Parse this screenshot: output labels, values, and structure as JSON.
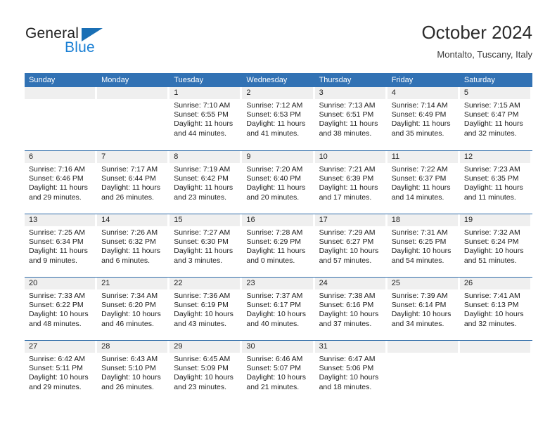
{
  "brand": {
    "name_part1": "General",
    "name_part2": "Blue",
    "triangle_color": "#1a6fb5",
    "blue_color": "#1a7fd4"
  },
  "header": {
    "title": "October 2024",
    "location": "Montalto, Tuscany, Italy"
  },
  "theme": {
    "header_blue": "#3272b4",
    "row_divider_blue": "#2f6ca9",
    "day_band_gray": "#efefef"
  },
  "weekdays": [
    "Sunday",
    "Monday",
    "Tuesday",
    "Wednesday",
    "Thursday",
    "Friday",
    "Saturday"
  ],
  "weeks": [
    [
      {
        "day": "",
        "sunrise": "",
        "sunset": "",
        "daylight": "",
        "empty": true
      },
      {
        "day": "",
        "sunrise": "",
        "sunset": "",
        "daylight": "",
        "empty": true
      },
      {
        "day": "1",
        "sunrise": "Sunrise: 7:10 AM",
        "sunset": "Sunset: 6:55 PM",
        "daylight": "Daylight: 11 hours and 44 minutes."
      },
      {
        "day": "2",
        "sunrise": "Sunrise: 7:12 AM",
        "sunset": "Sunset: 6:53 PM",
        "daylight": "Daylight: 11 hours and 41 minutes."
      },
      {
        "day": "3",
        "sunrise": "Sunrise: 7:13 AM",
        "sunset": "Sunset: 6:51 PM",
        "daylight": "Daylight: 11 hours and 38 minutes."
      },
      {
        "day": "4",
        "sunrise": "Sunrise: 7:14 AM",
        "sunset": "Sunset: 6:49 PM",
        "daylight": "Daylight: 11 hours and 35 minutes."
      },
      {
        "day": "5",
        "sunrise": "Sunrise: 7:15 AM",
        "sunset": "Sunset: 6:47 PM",
        "daylight": "Daylight: 11 hours and 32 minutes."
      }
    ],
    [
      {
        "day": "6",
        "sunrise": "Sunrise: 7:16 AM",
        "sunset": "Sunset: 6:46 PM",
        "daylight": "Daylight: 11 hours and 29 minutes."
      },
      {
        "day": "7",
        "sunrise": "Sunrise: 7:17 AM",
        "sunset": "Sunset: 6:44 PM",
        "daylight": "Daylight: 11 hours and 26 minutes."
      },
      {
        "day": "8",
        "sunrise": "Sunrise: 7:19 AM",
        "sunset": "Sunset: 6:42 PM",
        "daylight": "Daylight: 11 hours and 23 minutes."
      },
      {
        "day": "9",
        "sunrise": "Sunrise: 7:20 AM",
        "sunset": "Sunset: 6:40 PM",
        "daylight": "Daylight: 11 hours and 20 minutes."
      },
      {
        "day": "10",
        "sunrise": "Sunrise: 7:21 AM",
        "sunset": "Sunset: 6:39 PM",
        "daylight": "Daylight: 11 hours and 17 minutes."
      },
      {
        "day": "11",
        "sunrise": "Sunrise: 7:22 AM",
        "sunset": "Sunset: 6:37 PM",
        "daylight": "Daylight: 11 hours and 14 minutes."
      },
      {
        "day": "12",
        "sunrise": "Sunrise: 7:23 AM",
        "sunset": "Sunset: 6:35 PM",
        "daylight": "Daylight: 11 hours and 11 minutes."
      }
    ],
    [
      {
        "day": "13",
        "sunrise": "Sunrise: 7:25 AM",
        "sunset": "Sunset: 6:34 PM",
        "daylight": "Daylight: 11 hours and 9 minutes."
      },
      {
        "day": "14",
        "sunrise": "Sunrise: 7:26 AM",
        "sunset": "Sunset: 6:32 PM",
        "daylight": "Daylight: 11 hours and 6 minutes."
      },
      {
        "day": "15",
        "sunrise": "Sunrise: 7:27 AM",
        "sunset": "Sunset: 6:30 PM",
        "daylight": "Daylight: 11 hours and 3 minutes."
      },
      {
        "day": "16",
        "sunrise": "Sunrise: 7:28 AM",
        "sunset": "Sunset: 6:29 PM",
        "daylight": "Daylight: 11 hours and 0 minutes."
      },
      {
        "day": "17",
        "sunrise": "Sunrise: 7:29 AM",
        "sunset": "Sunset: 6:27 PM",
        "daylight": "Daylight: 10 hours and 57 minutes."
      },
      {
        "day": "18",
        "sunrise": "Sunrise: 7:31 AM",
        "sunset": "Sunset: 6:25 PM",
        "daylight": "Daylight: 10 hours and 54 minutes."
      },
      {
        "day": "19",
        "sunrise": "Sunrise: 7:32 AM",
        "sunset": "Sunset: 6:24 PM",
        "daylight": "Daylight: 10 hours and 51 minutes."
      }
    ],
    [
      {
        "day": "20",
        "sunrise": "Sunrise: 7:33 AM",
        "sunset": "Sunset: 6:22 PM",
        "daylight": "Daylight: 10 hours and 48 minutes."
      },
      {
        "day": "21",
        "sunrise": "Sunrise: 7:34 AM",
        "sunset": "Sunset: 6:20 PM",
        "daylight": "Daylight: 10 hours and 46 minutes."
      },
      {
        "day": "22",
        "sunrise": "Sunrise: 7:36 AM",
        "sunset": "Sunset: 6:19 PM",
        "daylight": "Daylight: 10 hours and 43 minutes."
      },
      {
        "day": "23",
        "sunrise": "Sunrise: 7:37 AM",
        "sunset": "Sunset: 6:17 PM",
        "daylight": "Daylight: 10 hours and 40 minutes."
      },
      {
        "day": "24",
        "sunrise": "Sunrise: 7:38 AM",
        "sunset": "Sunset: 6:16 PM",
        "daylight": "Daylight: 10 hours and 37 minutes."
      },
      {
        "day": "25",
        "sunrise": "Sunrise: 7:39 AM",
        "sunset": "Sunset: 6:14 PM",
        "daylight": "Daylight: 10 hours and 34 minutes."
      },
      {
        "day": "26",
        "sunrise": "Sunrise: 7:41 AM",
        "sunset": "Sunset: 6:13 PM",
        "daylight": "Daylight: 10 hours and 32 minutes."
      }
    ],
    [
      {
        "day": "27",
        "sunrise": "Sunrise: 6:42 AM",
        "sunset": "Sunset: 5:11 PM",
        "daylight": "Daylight: 10 hours and 29 minutes."
      },
      {
        "day": "28",
        "sunrise": "Sunrise: 6:43 AM",
        "sunset": "Sunset: 5:10 PM",
        "daylight": "Daylight: 10 hours and 26 minutes."
      },
      {
        "day": "29",
        "sunrise": "Sunrise: 6:45 AM",
        "sunset": "Sunset: 5:09 PM",
        "daylight": "Daylight: 10 hours and 23 minutes."
      },
      {
        "day": "30",
        "sunrise": "Sunrise: 6:46 AM",
        "sunset": "Sunset: 5:07 PM",
        "daylight": "Daylight: 10 hours and 21 minutes."
      },
      {
        "day": "31",
        "sunrise": "Sunrise: 6:47 AM",
        "sunset": "Sunset: 5:06 PM",
        "daylight": "Daylight: 10 hours and 18 minutes."
      },
      {
        "day": "",
        "sunrise": "",
        "sunset": "",
        "daylight": "",
        "empty": true
      },
      {
        "day": "",
        "sunrise": "",
        "sunset": "",
        "daylight": "",
        "empty": true
      }
    ]
  ]
}
